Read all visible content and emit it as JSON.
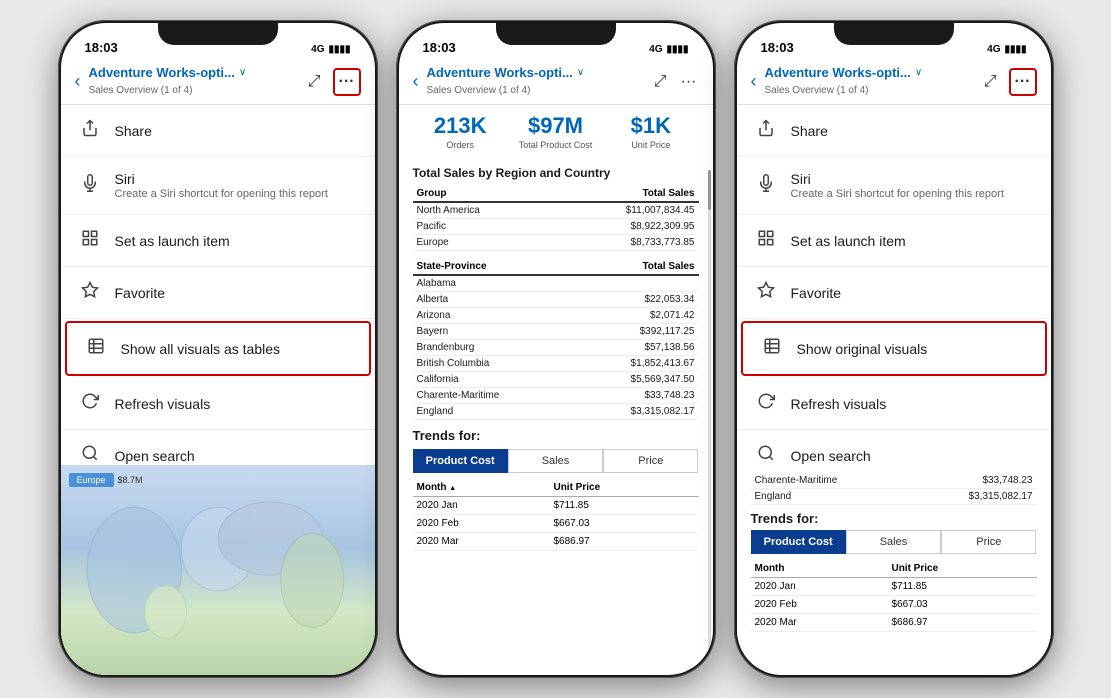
{
  "phones": [
    {
      "id": "phone1",
      "type": "menu",
      "status": {
        "time": "18:03",
        "signal": "4G",
        "battery": "▮▮▮▮"
      },
      "nav": {
        "back": "‹",
        "title": "Adventure Works-opti...",
        "chevron": "∨",
        "subtitle": "Sales Overview (1 of 4)",
        "icons": [
          "⤢",
          "···"
        ]
      },
      "menu": [
        {
          "icon": "↑",
          "label": "Share",
          "sublabel": ""
        },
        {
          "icon": "🎤",
          "label": "Siri",
          "sublabel": "Create a Siri shortcut for opening this report",
          "hasSubLabel": true
        },
        {
          "icon": "⊞",
          "label": "Set as launch item",
          "sublabel": ""
        },
        {
          "icon": "☆",
          "label": "Favorite",
          "sublabel": ""
        },
        {
          "icon": "▦",
          "label": "Show all visuals as tables",
          "sublabel": "",
          "highlighted": true
        },
        {
          "icon": "↺",
          "label": "Refresh visuals",
          "sublabel": ""
        },
        {
          "icon": "🔍",
          "label": "Open search",
          "sublabel": ""
        }
      ],
      "bgMap": {
        "europeLabel": "Europe",
        "europeValue": "$8.7M"
      }
    },
    {
      "id": "phone2",
      "type": "content",
      "status": {
        "time": "18:03",
        "signal": "4G",
        "battery": "▮▮▮▮"
      },
      "nav": {
        "back": "‹",
        "title": "Adventure Works-opti...",
        "chevron": "∨",
        "subtitle": "Sales Overview (1 of 4)",
        "icons": [
          "⤢",
          "···"
        ]
      },
      "kpis": [
        {
          "value": "213K",
          "label": "Orders"
        },
        {
          "value": "$97M",
          "label": "Total Product Cost"
        },
        {
          "value": "$1K",
          "label": "Unit Price"
        }
      ],
      "regionTable": {
        "title": "Total Sales by Region and Country",
        "headers": [
          "Group",
          "Total Sales"
        ],
        "rows": [
          [
            "North America",
            "$11,007,834.45"
          ],
          [
            "Pacific",
            "$8,922,309.95"
          ],
          [
            "Europe",
            "$8,733,773.85"
          ]
        ]
      },
      "stateTable": {
        "headers": [
          "State-Province",
          "Total Sales"
        ],
        "rows": [
          [
            "Alabama",
            ""
          ],
          [
            "Alberta",
            "$22,053.34"
          ],
          [
            "Arizona",
            "$2,071.42"
          ],
          [
            "Bayern",
            "$392,117.25"
          ],
          [
            "Brandenburg",
            "$57,138.56"
          ],
          [
            "British Columbia",
            "$1,852,413.67"
          ],
          [
            "California",
            "$5,569,347.50"
          ],
          [
            "Charente-Maritime",
            "$33,748.23"
          ],
          [
            "England",
            "$3,315,082.17"
          ]
        ]
      },
      "trends": {
        "label": "Trends for:",
        "tabs": [
          "Product Cost",
          "Sales",
          "Price"
        ],
        "activeTab": 0,
        "tableHeaders": [
          "Month ▲",
          "Unit Price"
        ],
        "tableRows": [
          [
            "2020 Jan",
            "$711.85"
          ],
          [
            "2020 Feb",
            "$667.03"
          ],
          [
            "2020 Mar",
            "$686.97"
          ]
        ]
      }
    },
    {
      "id": "phone3",
      "type": "menu-with-content",
      "status": {
        "time": "18:03",
        "signal": "4G",
        "battery": "▮▮▮▮"
      },
      "nav": {
        "back": "‹",
        "title": "Adventure Works-opti...",
        "chevron": "∨",
        "subtitle": "Sales Overview (1 of 4)",
        "icons": [
          "⤢",
          "···"
        ]
      },
      "menu": [
        {
          "icon": "↑",
          "label": "Share",
          "sublabel": ""
        },
        {
          "icon": "🎤",
          "label": "Siri",
          "sublabel": "Create a Siri shortcut for opening this report",
          "hasSubLabel": true
        },
        {
          "icon": "⊞",
          "label": "Set as launch item",
          "sublabel": ""
        },
        {
          "icon": "☆",
          "label": "Favorite",
          "sublabel": ""
        },
        {
          "icon": "▦",
          "label": "Show original visuals",
          "sublabel": "",
          "highlighted": true
        },
        {
          "icon": "↺",
          "label": "Refresh visuals",
          "sublabel": ""
        },
        {
          "icon": "🔍",
          "label": "Open search",
          "sublabel": ""
        }
      ],
      "bgContent": {
        "stateRows": [
          [
            "Charente-Maritime",
            "$33,748.23"
          ],
          [
            "England",
            "$3,315,082.17"
          ]
        ],
        "trends": {
          "label": "Trends for:",
          "tabs": [
            "Product Cost",
            "Sales",
            "Price"
          ],
          "activeTab": 0,
          "tableHeaders": [
            "Month",
            "Unit Price"
          ],
          "tableRows": [
            [
              "2020 Jan",
              "$711.85"
            ],
            [
              "2020 Feb",
              "$667.03"
            ],
            [
              "2020 Mar",
              "$686.97"
            ]
          ]
        }
      }
    }
  ]
}
